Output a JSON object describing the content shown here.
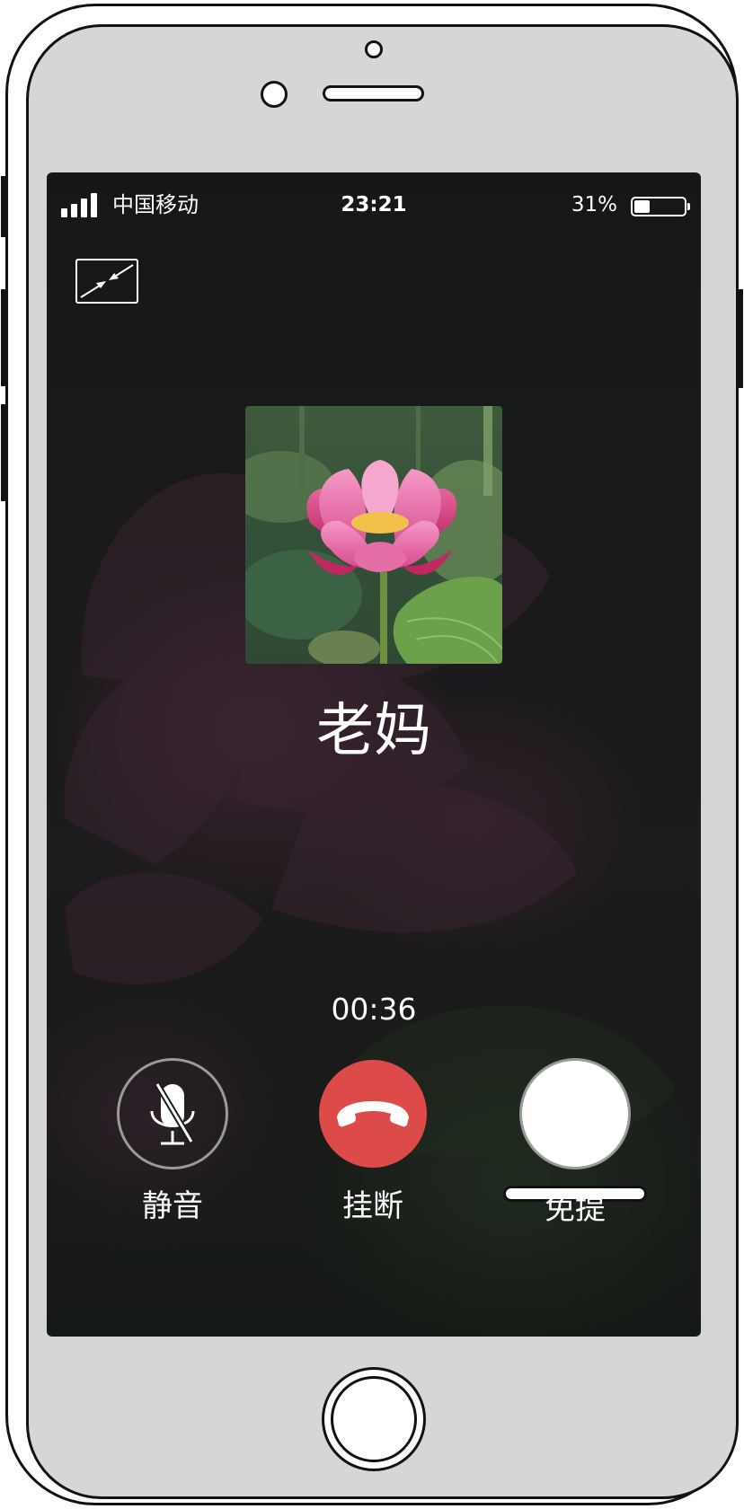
{
  "status_bar": {
    "carrier": "中国移动",
    "time": "23:21",
    "battery_percent_text": "31%",
    "battery_level": 0.31,
    "signal_bars": 4
  },
  "call": {
    "caller_name": "老妈",
    "duration": "00:36",
    "avatar_image": "pink-lotus-flower"
  },
  "controls": {
    "mute_label": "静音",
    "hangup_label": "挂断",
    "speaker_label": "免提"
  },
  "icons": {
    "minimize": "minimize-arrows-icon",
    "mute": "microphone-off-icon",
    "hangup": "phone-hangup-icon",
    "speaker": "speaker-volume-icon"
  },
  "colors": {
    "hangup_red": "#dc4b49",
    "button_outline": "#9a9a9a",
    "phone_body": "#d6d6d8",
    "screen_background": "#1b1a1b"
  }
}
